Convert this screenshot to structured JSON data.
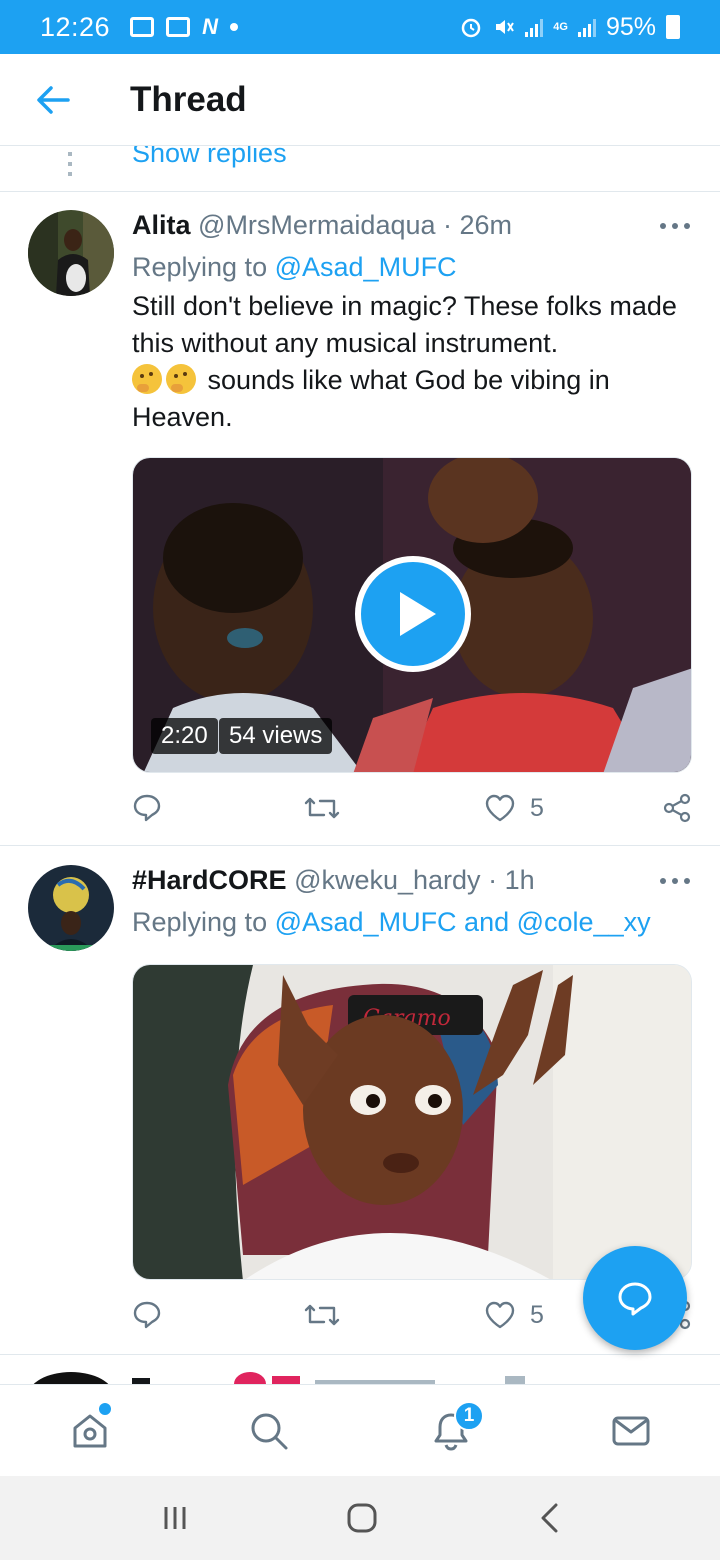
{
  "status_bar": {
    "time": "12:26",
    "network": "4G",
    "battery": "95%"
  },
  "header": {
    "title": "Thread"
  },
  "show_replies": {
    "label": "Show replies"
  },
  "tweets": [
    {
      "name": "Alita",
      "handle": "@MrsMermaidaqua",
      "time": "· 26m",
      "replying_prefix": "Replying to",
      "mentions": "@Asad_MUFC",
      "text_line1": "Still don't believe in magic? These folks made this without any musical instrument.",
      "text_line2": "sounds like what God be vibing in Heaven.",
      "media_type": "video",
      "video_duration": "2:20",
      "video_views": "54 views",
      "likes": "5"
    },
    {
      "name": "#HardCORE",
      "handle": "@kweku_hardy",
      "time": "· 1h",
      "replying_prefix": "Replying to",
      "mentions": "@Asad_MUFC and @cole__xy",
      "media_type": "image",
      "image_caption_text": "Caramo",
      "likes": "5"
    }
  ],
  "bottom_nav": {
    "notifications_badge": "1"
  },
  "colors": {
    "accent": "#1da1f2",
    "text_primary": "#14171a",
    "text_secondary": "#657786",
    "divider": "#e1e8ed"
  },
  "icons": [
    "back-arrow-icon",
    "more-icon",
    "reply-icon",
    "retweet-icon",
    "like-icon",
    "share-icon",
    "compose-icon",
    "home-icon",
    "search-icon",
    "notifications-icon",
    "messages-icon"
  ]
}
